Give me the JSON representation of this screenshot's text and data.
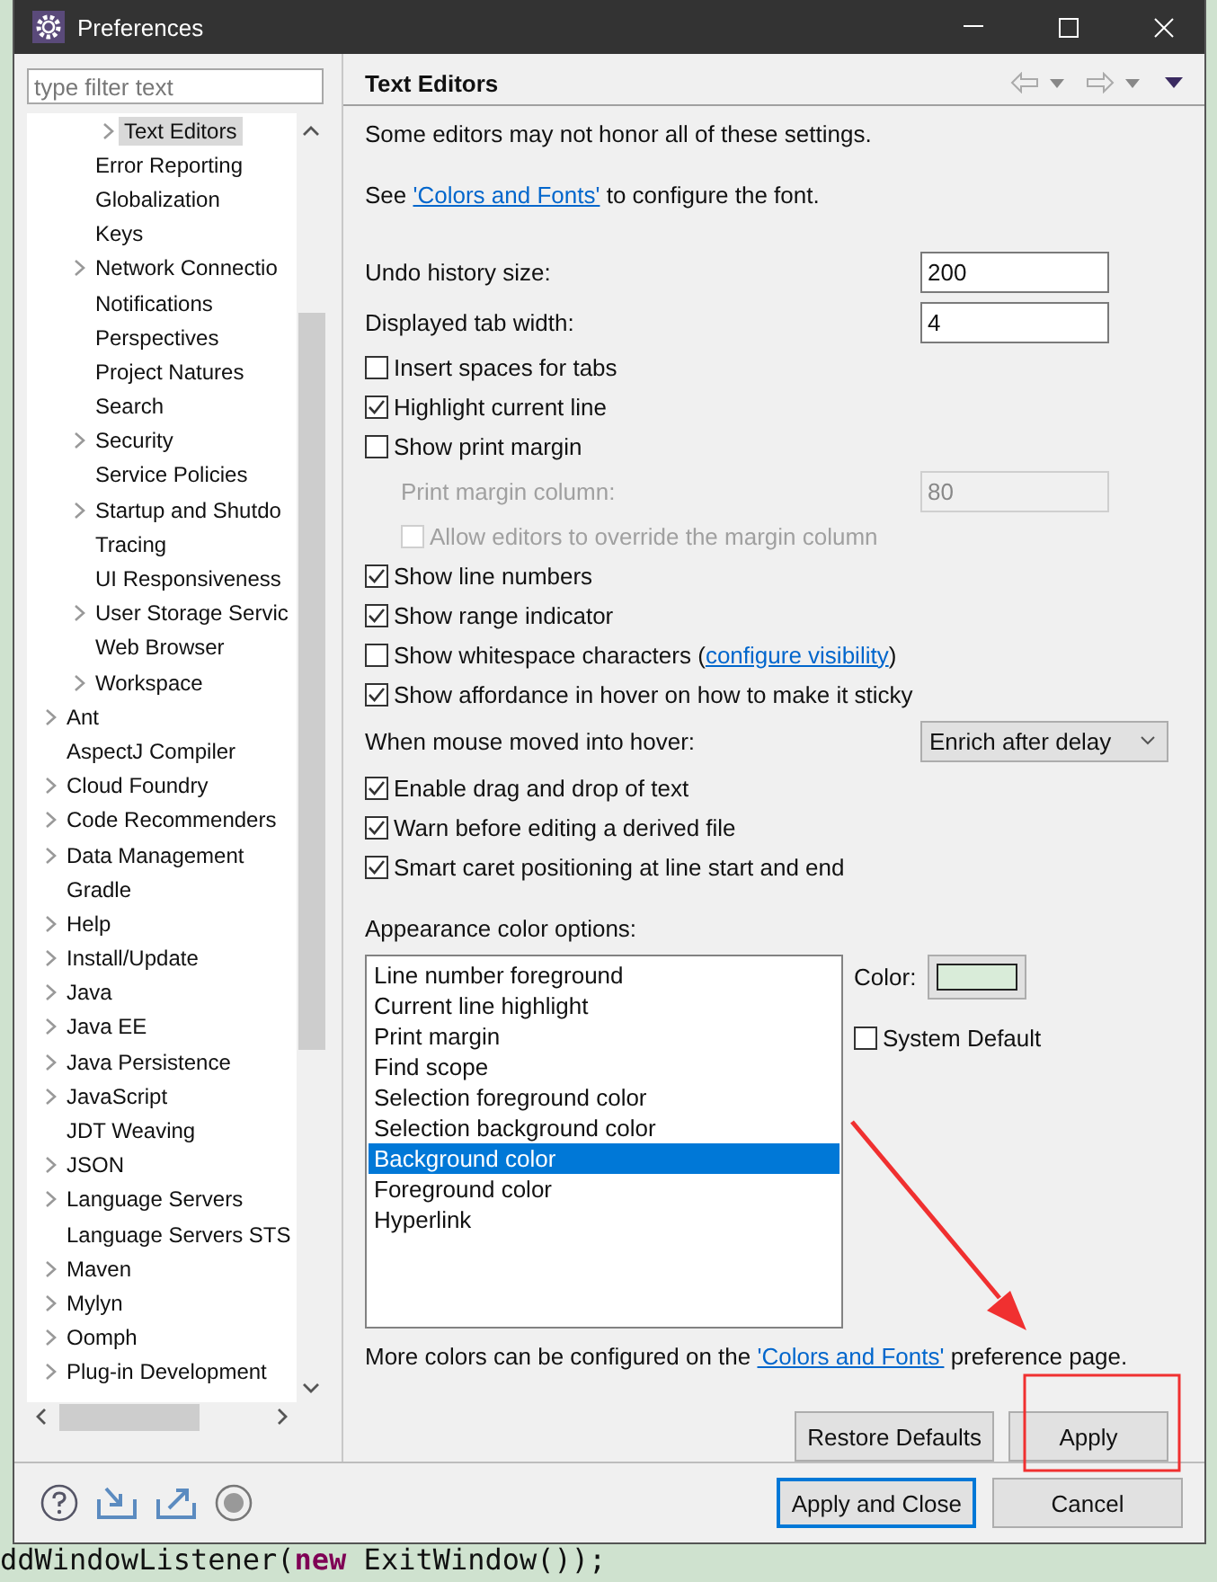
{
  "window": {
    "title": "Preferences"
  },
  "filter": {
    "placeholder": "type filter text"
  },
  "tree": {
    "items": [
      {
        "children": [
          {
            "children": [
              {
                "label": "Text Editors",
                "expandable": true,
                "selected": true
              }
            ]
          },
          {
            "label": "Error Reporting",
            "expandable": false,
            "selected": false
          },
          {
            "label": "Globalization",
            "expandable": false,
            "selected": false
          },
          {
            "label": "Keys",
            "expandable": false,
            "selected": false
          },
          {
            "label": "Network Connectio",
            "expandable": true,
            "selected": false
          },
          {
            "label": "Notifications",
            "expandable": false,
            "selected": false
          },
          {
            "label": "Perspectives",
            "expandable": false,
            "selected": false
          },
          {
            "label": "Project Natures",
            "expandable": false,
            "selected": false
          },
          {
            "label": "Search",
            "expandable": false,
            "selected": false
          },
          {
            "label": "Security",
            "expandable": true,
            "selected": false
          },
          {
            "label": "Service Policies",
            "expandable": false,
            "selected": false
          },
          {
            "label": "Startup and Shutdo",
            "expandable": true,
            "selected": false
          },
          {
            "label": "Tracing",
            "expandable": false,
            "selected": false
          },
          {
            "label": "UI Responsiveness",
            "expandable": false,
            "selected": false
          },
          {
            "label": "User Storage Servic",
            "expandable": true,
            "selected": false
          },
          {
            "label": "Web Browser",
            "expandable": false,
            "selected": false
          },
          {
            "label": "Workspace",
            "expandable": true,
            "selected": false
          }
        ]
      },
      {
        "label": "Ant",
        "expandable": true,
        "selected": false
      },
      {
        "label": "AspectJ Compiler",
        "expandable": false,
        "selected": false
      },
      {
        "label": "Cloud Foundry",
        "expandable": true,
        "selected": false
      },
      {
        "label": "Code Recommenders",
        "expandable": true,
        "selected": false
      },
      {
        "label": "Data Management",
        "expandable": true,
        "selected": false
      },
      {
        "label": "Gradle",
        "expandable": false,
        "selected": false
      },
      {
        "label": "Help",
        "expandable": true,
        "selected": false
      },
      {
        "label": "Install/Update",
        "expandable": true,
        "selected": false
      },
      {
        "label": "Java",
        "expandable": true,
        "selected": false
      },
      {
        "label": "Java EE",
        "expandable": true,
        "selected": false
      },
      {
        "label": "Java Persistence",
        "expandable": true,
        "selected": false
      },
      {
        "label": "JavaScript",
        "expandable": true,
        "selected": false
      },
      {
        "label": "JDT Weaving",
        "expandable": false,
        "selected": false
      },
      {
        "label": "JSON",
        "expandable": true,
        "selected": false
      },
      {
        "label": "Language Servers",
        "expandable": true,
        "selected": false
      },
      {
        "label": "Language Servers STS",
        "expandable": false,
        "selected": false
      },
      {
        "label": "Maven",
        "expandable": true,
        "selected": false
      },
      {
        "label": "Mylyn",
        "expandable": true,
        "selected": false
      },
      {
        "label": "Oomph",
        "expandable": true,
        "selected": false
      },
      {
        "label": "Plug-in Development",
        "expandable": true,
        "selected": false
      }
    ]
  },
  "page": {
    "title": "Text Editors",
    "intro": "Some editors may not honor all of these settings.",
    "font_note": {
      "before": "See ",
      "link": "'Colors and Fonts'",
      "after": " to configure the font."
    },
    "settings": [
      {
        "kind": "field",
        "label": "Undo history size:",
        "value": "200",
        "disabled": false
      },
      {
        "kind": "field",
        "label": "Displayed tab width:",
        "value": "4",
        "disabled": false
      },
      {
        "kind": "checkbox",
        "label": "Insert spaces for tabs",
        "checked": false,
        "disabled": false
      },
      {
        "kind": "checkbox",
        "label": "Highlight current line",
        "checked": true,
        "disabled": false
      },
      {
        "kind": "checkbox",
        "label": "Show print margin",
        "checked": false,
        "disabled": false,
        "children": [
          {
            "kind": "field",
            "label": "Print margin column:",
            "value": "80",
            "disabled": true
          },
          {
            "kind": "checkbox",
            "label": "Allow editors to override the margin column",
            "checked": false,
            "disabled": true
          }
        ]
      },
      {
        "kind": "checkbox",
        "label": "Show line numbers",
        "checked": true,
        "disabled": false
      },
      {
        "kind": "checkbox",
        "label": "Show range indicator",
        "checked": true,
        "disabled": false
      },
      {
        "kind": "checkbox",
        "label": "Show whitespace characters",
        "checked": false,
        "disabled": false,
        "link_before": "(",
        "link": "configure visibility",
        "link_after": ")"
      },
      {
        "kind": "checkbox",
        "label": "Show affordance in hover on how to make it sticky",
        "checked": true,
        "disabled": false
      },
      {
        "kind": "select",
        "label": "When mouse moved into hover:",
        "value": "Enrich after delay"
      },
      {
        "kind": "checkbox",
        "label": "Enable drag and drop of text",
        "checked": true,
        "disabled": false
      },
      {
        "kind": "checkbox",
        "label": "Warn before editing a derived file",
        "checked": true,
        "disabled": false
      },
      {
        "kind": "checkbox",
        "label": "Smart caret positioning at line start and end",
        "checked": true,
        "disabled": false
      }
    ],
    "appearance": {
      "label": "Appearance color options:",
      "options": [
        {
          "label": "Line number foreground",
          "selected": false
        },
        {
          "label": "Current line highlight",
          "selected": false
        },
        {
          "label": "Print margin",
          "selected": false
        },
        {
          "label": "Find scope",
          "selected": false
        },
        {
          "label": "Selection foreground color",
          "selected": false
        },
        {
          "label": "Selection background color",
          "selected": false
        },
        {
          "label": "Background color",
          "selected": true
        },
        {
          "label": "Foreground color",
          "selected": false
        },
        {
          "label": "Hyperlink",
          "selected": false
        }
      ],
      "color_label": "Color:",
      "color": "#d9ecd9",
      "system_default": {
        "label": "System Default",
        "checked": false
      }
    },
    "more_note": {
      "before": "More colors can be configured on the ",
      "link": "'Colors and Fonts'",
      "after": " preference page."
    },
    "buttons": [
      "Restore Defaults",
      "Apply"
    ]
  },
  "footer": {
    "buttons": [
      {
        "label": "Apply and Close",
        "default": true
      },
      {
        "label": "Cancel",
        "default": false
      }
    ]
  },
  "background_editor": {
    "code_line": "ddWindowListener(**new** ExitWindow());"
  }
}
